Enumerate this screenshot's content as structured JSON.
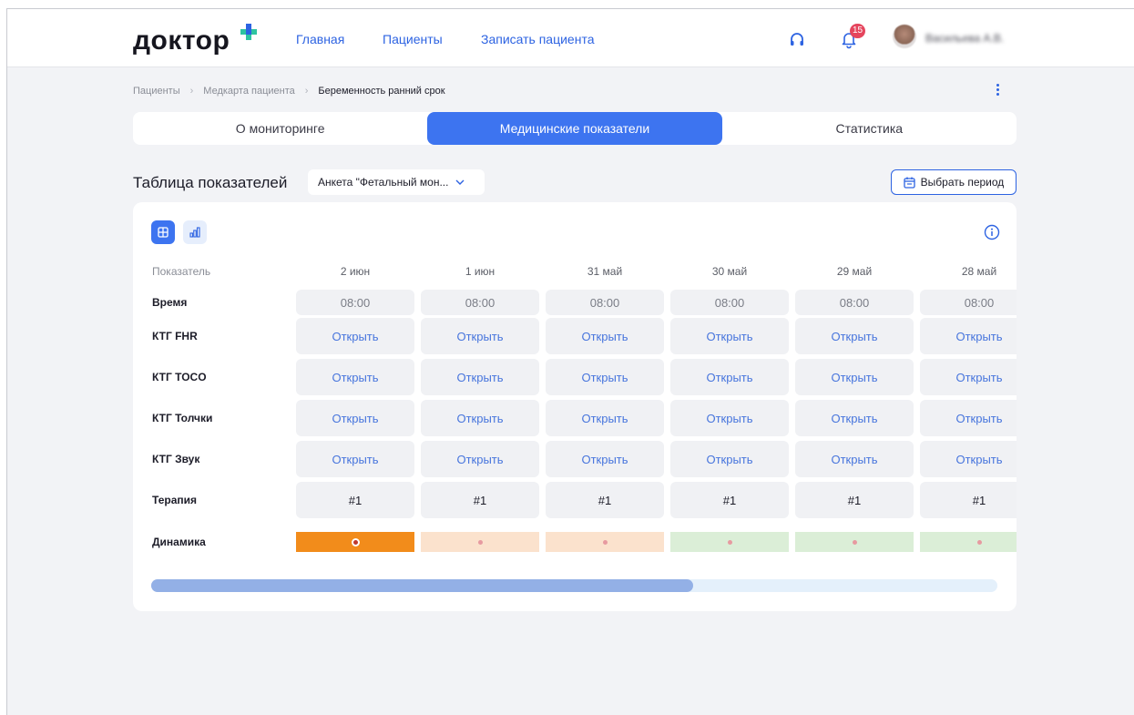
{
  "header": {
    "logo_text": "доктор",
    "nav": [
      "Главная",
      "Пациенты",
      "Записать пациента"
    ],
    "notification_count": "15",
    "user_name": "Васильева А.В."
  },
  "breadcrumb": [
    "Пациенты",
    "Медкарта пациента",
    "Беременность ранний срок"
  ],
  "tabs": [
    "О мониторинге",
    "Медицинские показатели",
    "Статистика"
  ],
  "active_tab": 1,
  "section": {
    "title": "Таблица показателей",
    "select_value": "Анкета \"Фетальный мон...",
    "period_button": "Выбрать период"
  },
  "table": {
    "header_label": "Показатель",
    "dates": [
      "2 июн",
      "1 июн",
      "31 май",
      "30 май",
      "29 май",
      "28 май"
    ],
    "rows": [
      {
        "label": "Время",
        "type": "time",
        "values": [
          "08:00",
          "08:00",
          "08:00",
          "08:00",
          "08:00",
          "08:00"
        ]
      },
      {
        "label": "КТГ FHR",
        "type": "link",
        "values": [
          "Открыть",
          "Открыть",
          "Открыть",
          "Открыть",
          "Открыть",
          "Открыть"
        ]
      },
      {
        "label": "КТГ TOCO",
        "type": "link",
        "values": [
          "Открыть",
          "Открыть",
          "Открыть",
          "Открыть",
          "Открыть",
          "Открыть"
        ]
      },
      {
        "label": "КТГ Толчки",
        "type": "link",
        "values": [
          "Открыть",
          "Открыть",
          "Открыть",
          "Открыть",
          "Открыть",
          "Открыть"
        ]
      },
      {
        "label": "КТГ Звук",
        "type": "link",
        "values": [
          "Открыть",
          "Открыть",
          "Открыть",
          "Открыть",
          "Открыть",
          "Открыть"
        ]
      },
      {
        "label": "Терапия",
        "type": "therapy",
        "values": [
          "#1",
          "#1",
          "#1",
          "#1",
          "#1",
          "#1"
        ]
      },
      {
        "label": "Динамика",
        "type": "dynamics",
        "values": [
          "",
          "",
          "",
          "",
          "",
          ""
        ]
      }
    ],
    "dynamics_status": [
      "critical",
      "warning",
      "warning",
      "normal",
      "normal",
      "normal"
    ]
  },
  "colors": {
    "accent": "#3d74f0",
    "link": "#4775dd",
    "status_critical_bg": "#f28c1b",
    "status_warning_bg": "#fbe2cd",
    "status_normal_bg": "#dbeed7",
    "status_critical_dot": "#c0392b",
    "status_dot": "#e79aa0",
    "badge": "#e5455d"
  },
  "icons": {
    "support": "headset-icon",
    "notifications": "bell-icon",
    "more": "kebab-menu-icon",
    "calendar": "calendar-icon",
    "table_view": "grid-icon",
    "chart_view": "bar-chart-icon",
    "info": "info-icon",
    "dropdown": "chevron-down-icon"
  },
  "scroll_progress": 0.64
}
